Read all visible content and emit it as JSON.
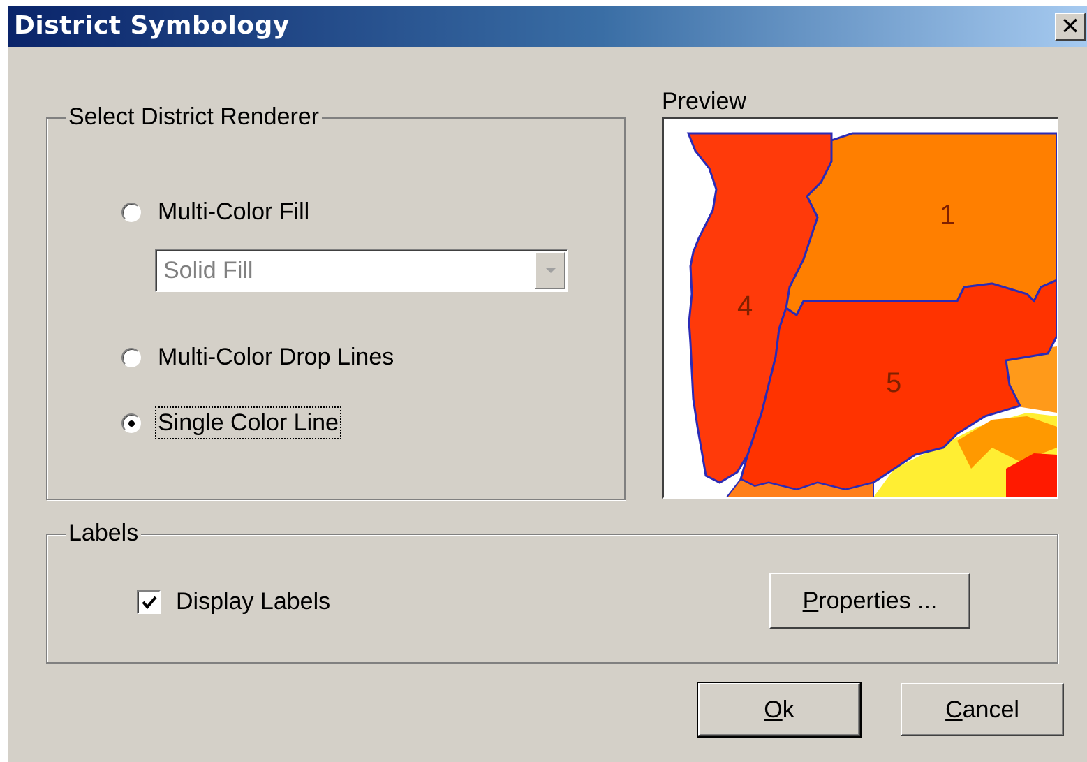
{
  "window": {
    "title": "District Symbology",
    "close_glyph": "✕"
  },
  "renderer_group": {
    "legend": "Select District Renderer",
    "options": [
      {
        "label": "Multi-Color Fill",
        "selected": false
      },
      {
        "label": "Multi-Color Drop Lines",
        "selected": false
      },
      {
        "label": "Single Color Line",
        "selected": true
      }
    ],
    "fill_style": {
      "value": "Solid Fill",
      "enabled": false
    }
  },
  "preview": {
    "label": "Preview",
    "district_labels": [
      "1",
      "4",
      "5"
    ],
    "colors": {
      "district_1": "#ff7f00",
      "district_4": "#ff3a0a",
      "district_5": "#ff3300",
      "yellow": "#ffff33",
      "boundary": "#2b2bb5"
    }
  },
  "labels_group": {
    "legend": "Labels",
    "display_labels": {
      "label": "Display Labels",
      "checked": true
    },
    "properties_button": "Properties ..."
  },
  "buttons": {
    "ok": "Ok",
    "cancel": "Cancel"
  }
}
